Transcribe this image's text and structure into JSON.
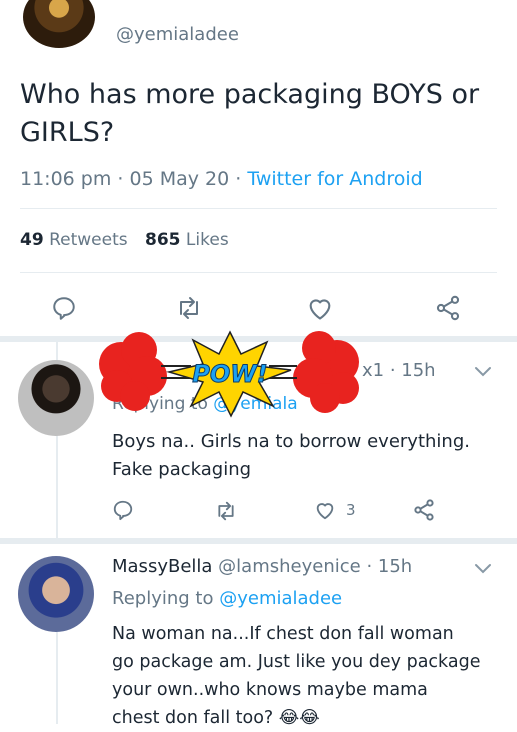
{
  "main_tweet": {
    "handle": "@yemialadee",
    "text": "Who has more packaging BOYS or GIRLS?",
    "time": "11:06 pm",
    "date": "05 May 20",
    "source": "Twitter for Android",
    "retweets_count": "49",
    "retweets_label": "Retweets",
    "likes_count": "865",
    "likes_label": "Likes"
  },
  "reply1": {
    "meta_visible": "x1 · 15h",
    "replying_label": "Replying to",
    "replying_handle": "@yemiala",
    "text_line1": "Boys na.. Girls na to borrow everything.",
    "text_line2": "Fake packaging",
    "like_count": "3",
    "sticker_text": "POW!"
  },
  "reply2": {
    "name": "MassyBella",
    "handle": "@lamsheyenice",
    "time": "· 15h",
    "replying_label": "Replying to",
    "replying_handle": "@yemialadee",
    "line1": "Na woman na...If chest don fall woman",
    "line2": "go package am. Just like you dey package",
    "line3": "your own..who knows maybe mama",
    "line4": "chest don fall too? 😂😂"
  },
  "colors": {
    "accent": "#1da1f2",
    "muted": "#657786",
    "divider": "#e6ecf0",
    "pow_red": "#e8231f",
    "pow_yellow": "#ffd400"
  },
  "icons": [
    "reply-icon",
    "retweet-icon",
    "like-icon",
    "share-icon",
    "chevron-down-icon"
  ]
}
